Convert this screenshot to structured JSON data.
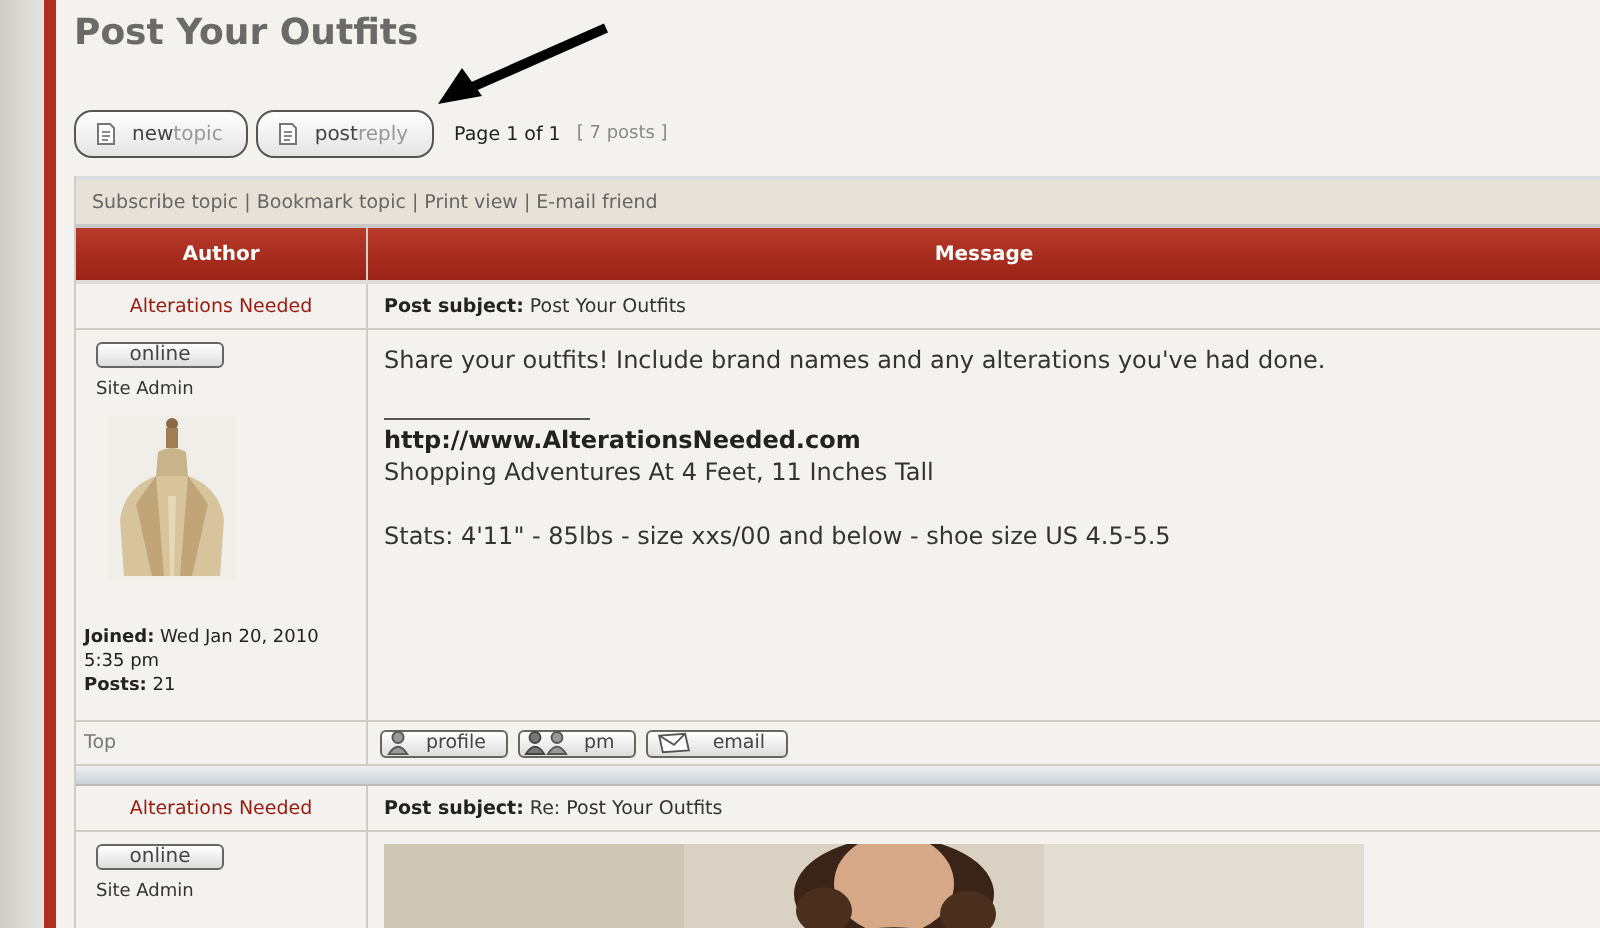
{
  "title": "Post Your Outfits",
  "action_buttons": [
    {
      "label": "**new**topic"
    },
    {
      "label": "**post**reply"
    }
  ],
  "pagination": {
    "page": "Page 1 of 1",
    "count": "[ 7 posts ]"
  },
  "topic_links": "Subscribe topic | Bookmark topic | Print view | E-mail friend",
  "table": {
    "columns": [
      "Author",
      "Message"
    ]
  },
  "posts": [
    {
      "author": "Alterations Needed",
      "subject": "**Post subject:** Post Your Outfits",
      "status": "online",
      "rank": "Site Admin",
      "avatar": true,
      "joined": "**Joined:** Wed Jan 20, 2010 5:35 pm",
      "posts": "**Posts:** 21",
      "body": [
        "Share your outfits! Include brand names and any alterations you've had done."
      ],
      "signature": {
        "url": "http://www.AlterationsNeeded.com",
        "tagline": "Shopping Adventures At 4 Feet, 11 Inches Tall",
        "stats": "Stats: 4'11\" - 85lbs - size xxs/00 and below - shoe size US 4.5-5.5"
      },
      "top": "Top",
      "buttons": [
        {
          "kind": "profile",
          "label": "profile"
        },
        {
          "kind": "pm",
          "label": "pm"
        },
        {
          "kind": "email",
          "label": "email"
        }
      ]
    },
    {
      "author": "Alterations Needed",
      "subject": "**Post subject:** Re: Post Your Outfits",
      "status": "online",
      "rank": "Site Admin"
    }
  ]
}
